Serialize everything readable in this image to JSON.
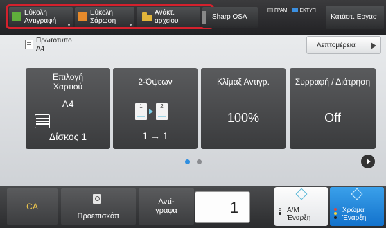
{
  "header": {
    "buttons": [
      {
        "label": "Εύκολη\nΑντιγραφή",
        "icon": "copy-icon"
      },
      {
        "label": "Εύκολη\nΣάρωση",
        "icon": "scan-icon"
      },
      {
        "label": "Ανάκτ.\nαρχείου",
        "icon": "folder-icon"
      },
      {
        "label": "Sharp OSA"
      }
    ],
    "status": {
      "line": "ΓΡΑΜ",
      "job": "ΕΚΤΥΠ"
    },
    "job_status_label": "Κατάστ. Εργασ."
  },
  "original": {
    "label": "Πρωτότυπο\nA4"
  },
  "details_label": "Λεπτομέρεια",
  "tiles": {
    "paper": {
      "title": "Επιλογή\nΧαρτιού",
      "size": "A4",
      "tray": "Δίσκος 1"
    },
    "duplex": {
      "title": "2-Όψεων",
      "value": "1 → 1",
      "page_front": "1",
      "page_back": "2"
    },
    "scale": {
      "title": "Κλίμαξ Αντιγρ.",
      "value": "100%"
    },
    "staple": {
      "title": "Συρραφή / Διάτρηση",
      "value": "Off"
    }
  },
  "footer": {
    "ca_label": "CA",
    "preview_label": "Προεπισκόπ",
    "copies_label": "Αντί-\nγραφα",
    "copies_value": "1",
    "bw_start_label": "Α/Μ\nΈναρξη",
    "color_start_label": "Χρώμα\nΈναρξη"
  },
  "colors": {
    "highlight": "#d4212d",
    "accent": "#2f8fe0"
  }
}
